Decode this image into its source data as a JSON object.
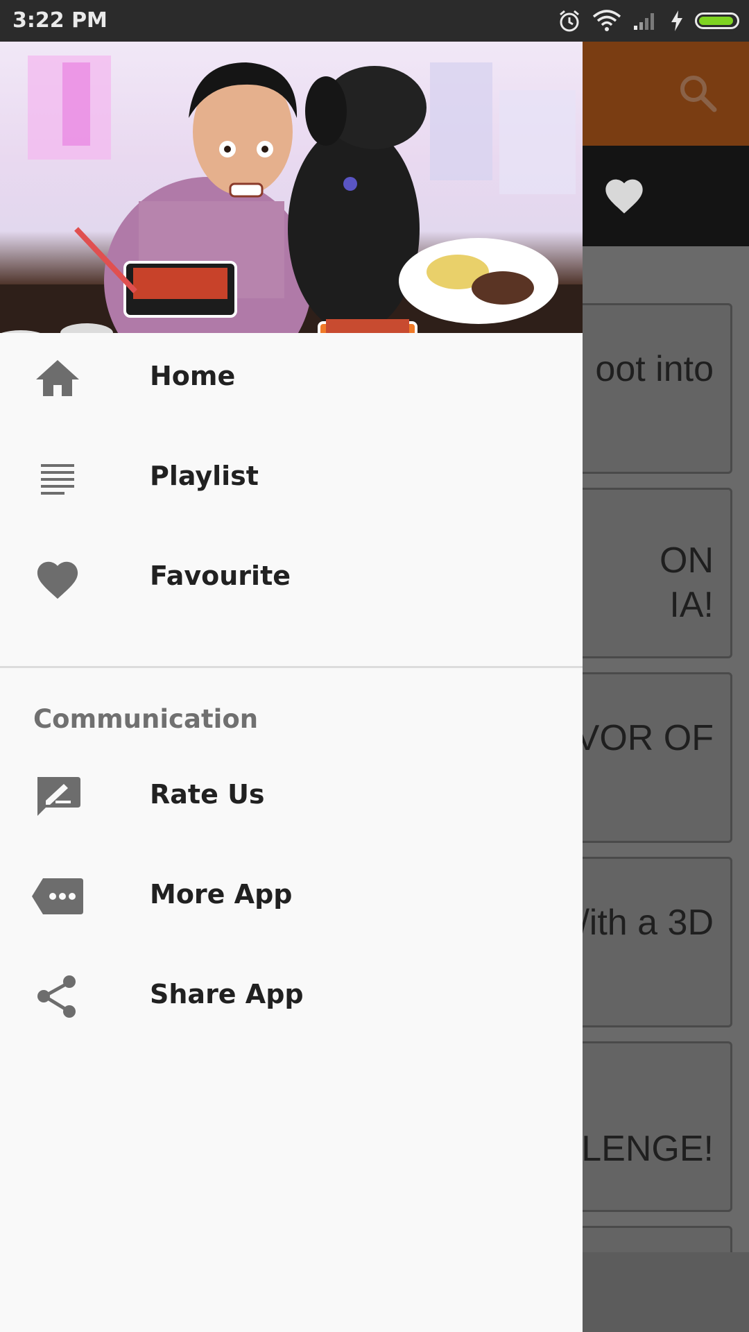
{
  "status_bar": {
    "time": "3:22 PM",
    "icons": [
      "alarm-icon",
      "wifi-icon",
      "signal-icon",
      "charging-icon",
      "battery-icon"
    ],
    "battery_level": 0.95,
    "battery_color": "#7ed321"
  },
  "background_app": {
    "toolbar_color": "#7a3d12",
    "cards": [
      {
        "text": "oot into"
      },
      {
        "text": "ON\nIA!"
      },
      {
        "text": "VOR OF"
      },
      {
        "text": "/ith a 3D"
      },
      {
        "text": "LLENGE!"
      },
      {
        "text": ""
      }
    ]
  },
  "drawer": {
    "header_image": "man-and-dog-eating-photo",
    "menu_items": [
      {
        "label": "Home",
        "icon": "home-icon"
      },
      {
        "label": "Playlist",
        "icon": "playlist-icon"
      },
      {
        "label": "Favourite",
        "icon": "heart-icon"
      }
    ],
    "section_title": "Communication",
    "communication_items": [
      {
        "label": "Rate Us",
        "icon": "rate-icon"
      },
      {
        "label": "More App",
        "icon": "more-icon"
      },
      {
        "label": "Share App",
        "icon": "share-icon"
      }
    ],
    "icon_color": "#6d6d6d"
  }
}
